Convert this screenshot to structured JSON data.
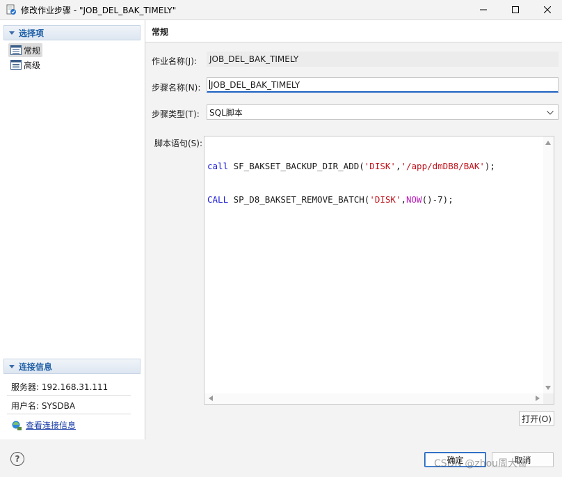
{
  "window": {
    "title": "修改作业步骤 - \"JOB_DEL_BAK_TIMELY\""
  },
  "sidebar": {
    "options_header": "选择项",
    "items": [
      {
        "label": "常规",
        "selected": true
      },
      {
        "label": "高级",
        "selected": false
      }
    ],
    "conn_header": "连接信息",
    "server": "服务器: 192.168.31.111",
    "user": "用户名: SYSDBA",
    "view_conn_link": "查看连接信息"
  },
  "main": {
    "section_title": "常规",
    "job_name_label": "作业名称(J):",
    "job_name_value": "JOB_DEL_BAK_TIMELY",
    "step_name_label": "步骤名称(N):",
    "step_name_value": "JOB_DEL_BAK_TIMELY",
    "step_type_label": "步骤类型(T):",
    "step_type_value": "SQL脚本",
    "script_label": "脚本语句(S):",
    "script_lines": [
      "call SF_BAKSET_BACKUP_DIR_ADD('DISK','/app/dmDB8/BAK');",
      "CALL SP_D8_BAKSET_REMOVE_BATCH('DISK',NOW()-7);"
    ],
    "open_button": "打开(O)"
  },
  "footer": {
    "ok_button": "确定",
    "cancel_button": "取消",
    "watermark": "CSDN @zhou周大哥"
  },
  "colors": {
    "accent": "#1f62c0",
    "keyword": "#1a1ad6",
    "string": "#c0121a",
    "function": "#c01ac0"
  }
}
